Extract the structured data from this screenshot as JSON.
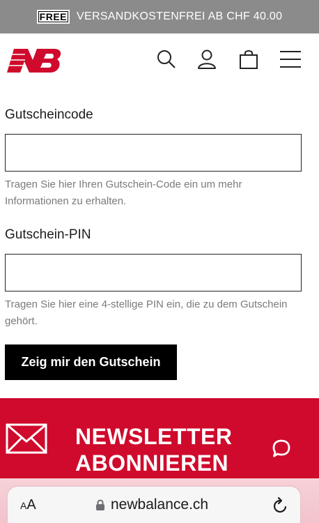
{
  "promo": {
    "badge": "FREE",
    "text": "VERSANDKOSTENFREI AB CHF 40.00"
  },
  "header": {
    "logo_alt": "NB",
    "icons": [
      "search-icon",
      "account-icon",
      "bag-icon",
      "menu-icon"
    ]
  },
  "form": {
    "code_label": "Gutscheincode",
    "code_value": "",
    "code_help": "Tragen Sie hier Ihren Gutschein-Code ein um mehr Informationen zu erhalten.",
    "pin_label": "Gutschein-PIN",
    "pin_value": "",
    "pin_help": "Tragen Sie hier eine 4-stellige PIN ein, die zu dem Gutschein gehört.",
    "submit_label": "Zeig mir den Gutschein"
  },
  "newsletter": {
    "title_line1": "NEWSLETTER",
    "title_line2": "ABONNIEREN"
  },
  "browser": {
    "aa_small": "A",
    "aa_large": "A",
    "url": "newbalance.ch"
  },
  "colors": {
    "brand_red": "#cf0a2c",
    "promo_gray": "#8b8b8b"
  }
}
